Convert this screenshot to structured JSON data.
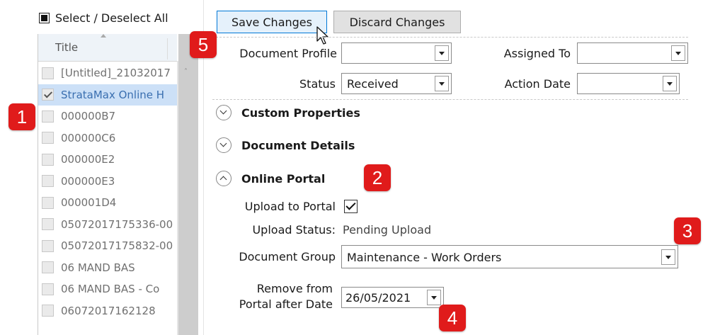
{
  "left_panel": {
    "select_all_label": "Select / Deselect All",
    "column_title": "Title",
    "items": [
      {
        "label": "[Untitled]_21032017",
        "checked": false,
        "selected": false
      },
      {
        "label": "StrataMax Online H",
        "checked": true,
        "selected": true
      },
      {
        "label": "000000B7",
        "checked": false,
        "selected": false
      },
      {
        "label": "000000C6",
        "checked": false,
        "selected": false
      },
      {
        "label": "000000E2",
        "checked": false,
        "selected": false
      },
      {
        "label": "000000E3",
        "checked": false,
        "selected": false
      },
      {
        "label": "000001D4",
        "checked": false,
        "selected": false
      },
      {
        "label": "05072017175336-00",
        "checked": false,
        "selected": false
      },
      {
        "label": "05072017175832-00",
        "checked": false,
        "selected": false
      },
      {
        "label": "06 MAND BAS",
        "checked": false,
        "selected": false
      },
      {
        "label": "06 MAND BAS - Co",
        "checked": false,
        "selected": false
      },
      {
        "label": "06072017162128",
        "checked": false,
        "selected": false
      }
    ]
  },
  "toolbar": {
    "save_label": "Save Changes",
    "discard_label": "Discard Changes"
  },
  "form": {
    "document_profile_label": "Document Profile",
    "document_profile_value": "",
    "assigned_to_label": "Assigned To",
    "assigned_to_value": "",
    "status_label": "Status",
    "status_value": "Received",
    "action_date_label": "Action Date",
    "action_date_value": ""
  },
  "sections": {
    "custom_properties": "Custom Properties",
    "document_details": "Document Details",
    "online_portal": "Online Portal"
  },
  "portal": {
    "upload_label": "Upload to Portal",
    "upload_checked": true,
    "upload_status_label": "Upload Status:",
    "upload_status_value": "Pending Upload",
    "document_group_label": "Document Group",
    "document_group_value": "Maintenance - Work Orders",
    "remove_label_line1": "Remove from",
    "remove_label_line2": "Portal after Date",
    "remove_date_value": "26/05/2021"
  },
  "badges": {
    "b1": "1",
    "b2": "2",
    "b3": "3",
    "b4": "4",
    "b5": "5"
  },
  "colors": {
    "badge": "#e01b1b",
    "selection": "#cce0f7",
    "primary_border": "#0078d7"
  }
}
